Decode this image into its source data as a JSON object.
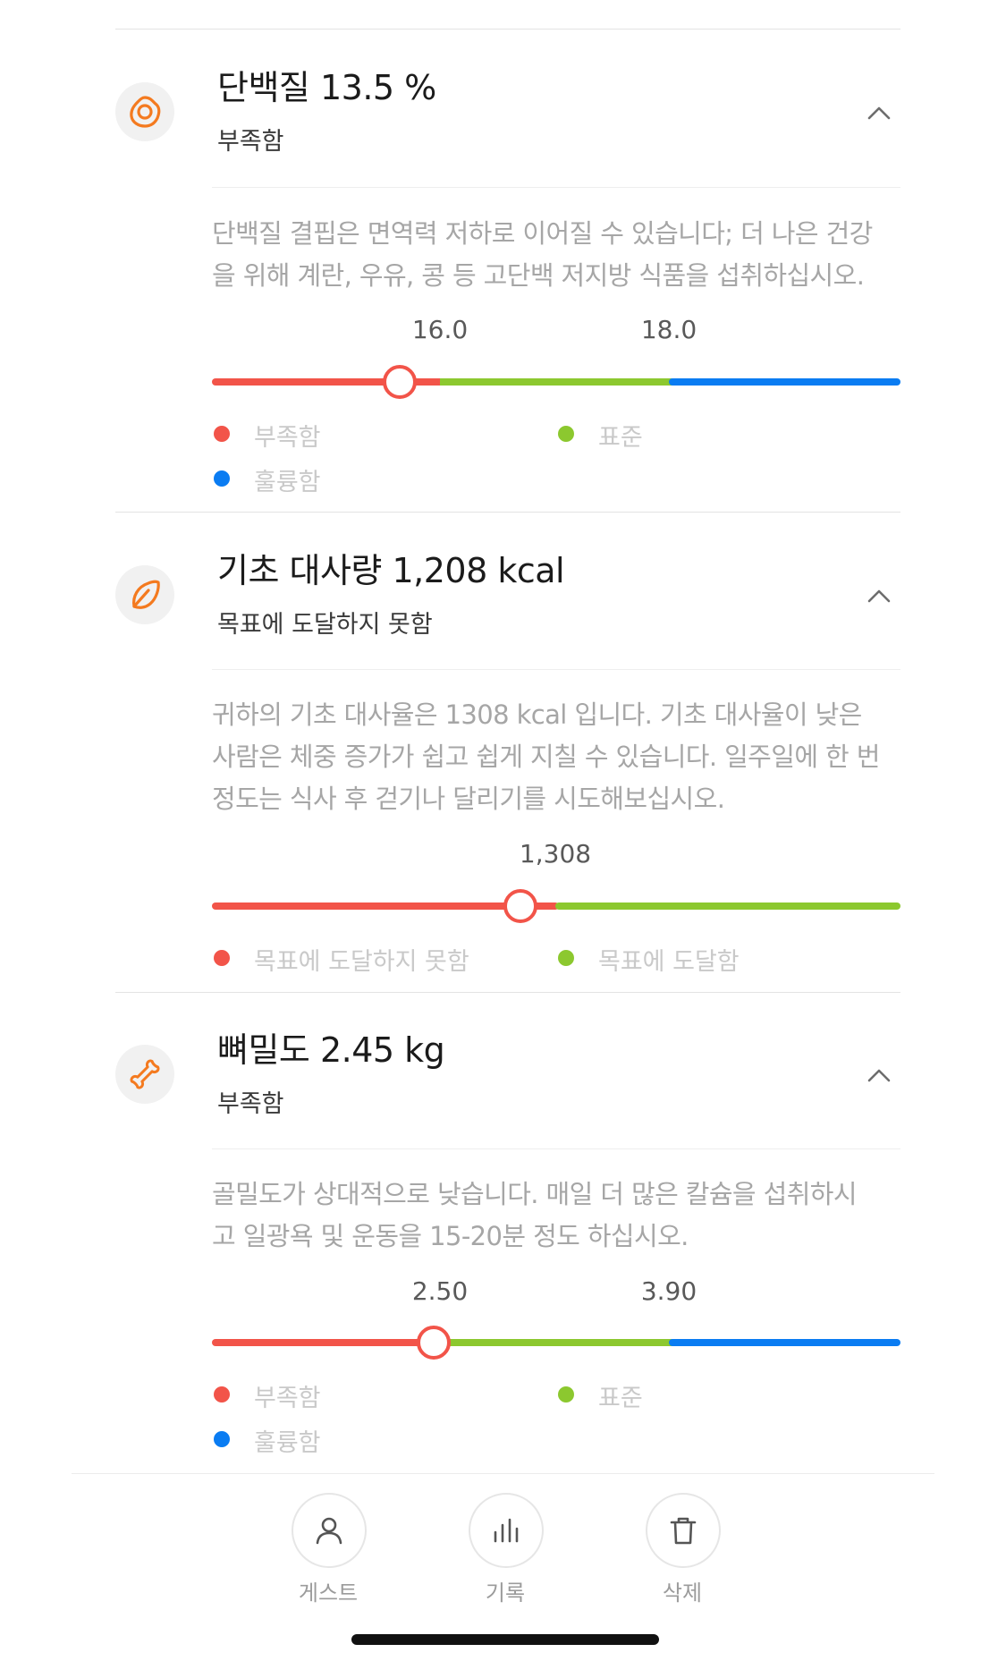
{
  "colors": {
    "low": "#f25449",
    "standard": "#8cc82f",
    "high": "#0a7cf2",
    "accent": "#f47a1f"
  },
  "protein": {
    "icon": "egg-icon",
    "title": "단백질 13.5 %",
    "status": "부족함",
    "desc_line1": "단백질 결핍은 면역력 저하로 이어질 수 있습니다; 더 나은 건강",
    "desc_line2": "을 위해 계란, 우유, 콩 등 고단백 저지방 식품을 섭취하십시오.",
    "thresholds": [
      "16.0",
      "18.0"
    ],
    "value": 13.5,
    "legend": [
      "부족함",
      "표준",
      "훌륭함"
    ]
  },
  "bmr": {
    "icon": "leaf-icon",
    "title": "기초 대사량 1,208 kcal",
    "status": "목표에 도달하지 못함",
    "desc_line1": "귀하의 기초 대사율은 1308 kcal 입니다. 기초 대사율이 낮은",
    "desc_line2": "사람은 체중 증가가 쉽고 쉽게 지칠 수 있습니다. 일주일에 한 번",
    "desc_line3": "정도는 식사 후 걷기나 달리기를 시도해보십시오.",
    "thresholds": [
      "1,308"
    ],
    "value": 1208,
    "legend": [
      "목표에 도달하지 못함",
      "목표에 도달함"
    ]
  },
  "bone": {
    "icon": "bone-icon",
    "title": "뼈밀도 2.45 kg",
    "status": "부족함",
    "desc_line1": "골밀도가 상대적으로 낮습니다. 매일 더 많은 칼슘을 섭취하시",
    "desc_line2": "고 일광욕 및 운동을 15-20분 정도 하십시오.",
    "thresholds": [
      "2.50",
      "3.90"
    ],
    "value": 2.45,
    "legend": [
      "부족함",
      "표준",
      "훌륭함"
    ]
  },
  "nav": {
    "guest": {
      "icon": "person-icon",
      "label": "게스트"
    },
    "history": {
      "icon": "bar-chart-icon",
      "label": "기록"
    },
    "delete": {
      "icon": "trash-icon",
      "label": "삭제"
    }
  }
}
